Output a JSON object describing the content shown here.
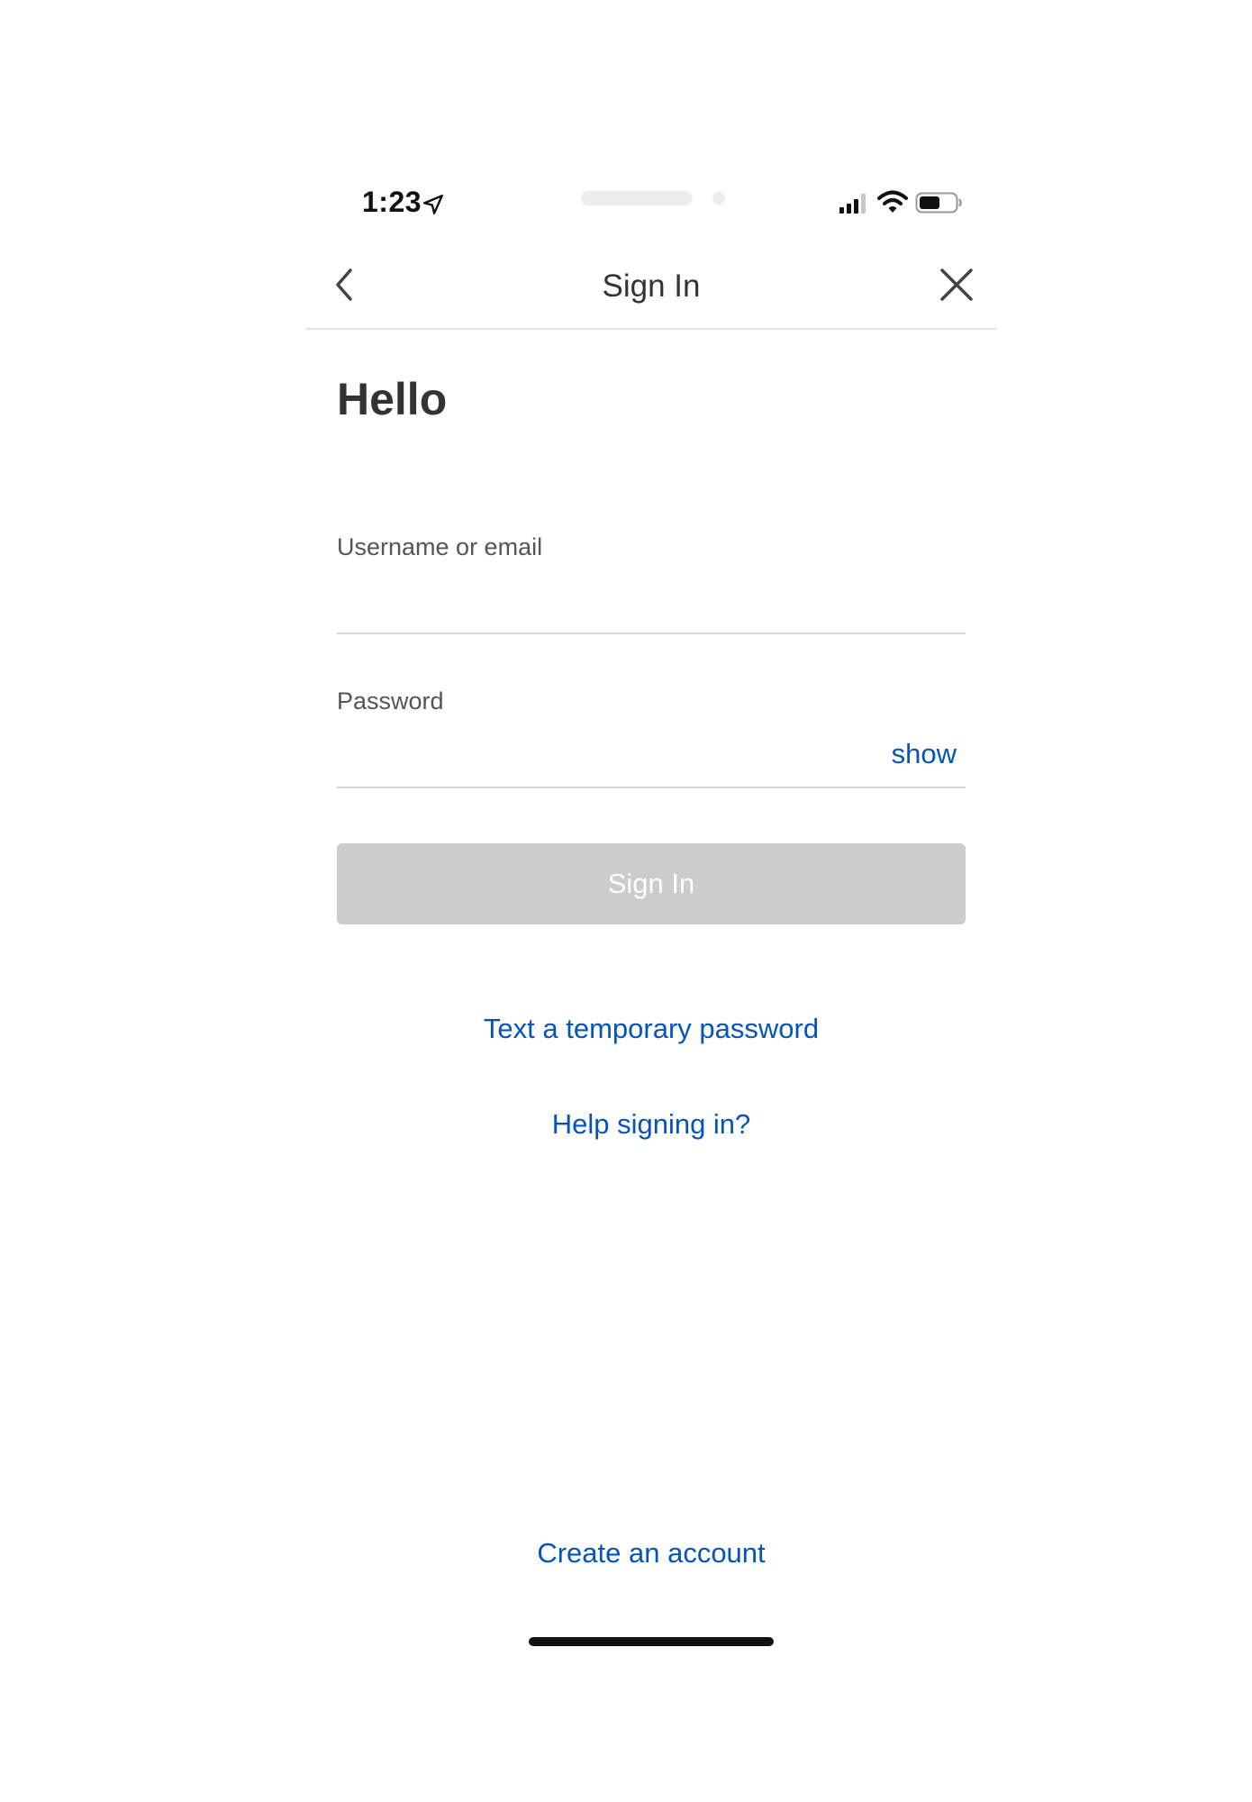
{
  "status_bar": {
    "time": "1:23",
    "icons": [
      "location-arrow-icon",
      "signal-bars-icon",
      "wifi-icon",
      "battery-icon"
    ]
  },
  "nav": {
    "title": "Sign In",
    "back_icon": "chevron-left-icon",
    "close_icon": "close-icon"
  },
  "main": {
    "heading": "Hello",
    "username": {
      "label": "Username or email",
      "value": ""
    },
    "password": {
      "label": "Password",
      "value": "",
      "toggle_label": "show"
    },
    "signin_button_label": "Sign In",
    "temp_password_link": "Text a temporary password",
    "help_link": "Help signing in?"
  },
  "footer": {
    "create_account_link": "Create an account"
  },
  "colors": {
    "link": "#0654ba",
    "button_disabled_bg": "#cccccc",
    "text": "#333333",
    "divider": "#d7d7d7"
  }
}
